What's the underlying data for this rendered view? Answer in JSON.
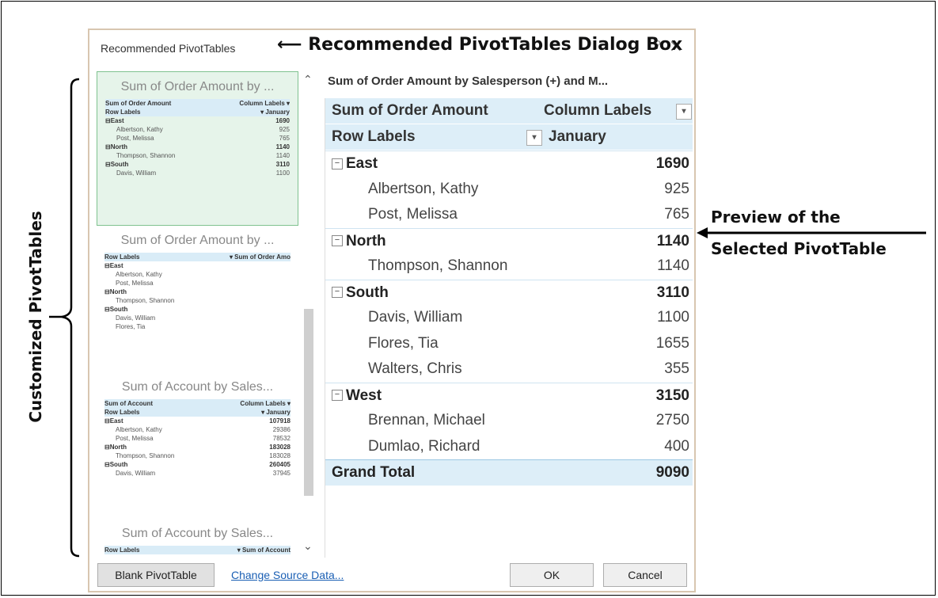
{
  "dialog": {
    "title": "Recommended PivotTables",
    "help_glyph": "?",
    "close_glyph": "×"
  },
  "annotations": {
    "dialog_box": "Recommended PivotTables Dialog Box",
    "preview_line1": "Preview of the",
    "preview_line2": "Selected PivotTable",
    "customized": "Customized PivotTables",
    "arrow_left": "⟵"
  },
  "gallery": {
    "thumbs": [
      {
        "title": "Sum of Order Amount by ...",
        "rows": [
          [
            "Sum of Order Amount",
            "Column Labels ▾",
            "hdr"
          ],
          [
            "Row Labels",
            "▾ January",
            "hdr"
          ],
          [
            "⊟East",
            "1690",
            "bold"
          ],
          [
            "Albertson, Kathy",
            "925",
            "sub"
          ],
          [
            "Post, Melissa",
            "765",
            "sub"
          ],
          [
            "⊟North",
            "1140",
            "bold"
          ],
          [
            "Thompson, Shannon",
            "1140",
            "sub"
          ],
          [
            "⊟South",
            "3110",
            "bold"
          ],
          [
            "Davis, William",
            "1100",
            "sub"
          ]
        ]
      },
      {
        "title": "Sum of Order Amount by ...",
        "rows": [
          [
            "Row Labels",
            "▾ Sum of Order Amo",
            "hdr"
          ],
          [
            "⊟East",
            "",
            "bold"
          ],
          [
            "Albertson, Kathy",
            "",
            "sub"
          ],
          [
            "Post, Melissa",
            "",
            "sub"
          ],
          [
            "⊟North",
            "",
            "bold"
          ],
          [
            "Thompson, Shannon",
            "",
            "sub"
          ],
          [
            "⊟South",
            "",
            "bold"
          ],
          [
            "Davis, William",
            "",
            "sub"
          ],
          [
            "Flores, Tia",
            "",
            "sub"
          ]
        ]
      },
      {
        "title": "Sum of Account by Sales...",
        "rows": [
          [
            "Sum of Account",
            "Column Labels ▾",
            "hdr"
          ],
          [
            "Row Labels",
            "▾ January",
            "hdr"
          ],
          [
            "⊟East",
            "107918",
            "bold"
          ],
          [
            "Albertson, Kathy",
            "29386",
            "sub"
          ],
          [
            "Post, Melissa",
            "78532",
            "sub"
          ],
          [
            "⊟North",
            "183028",
            "bold"
          ],
          [
            "Thompson, Shannon",
            "183028",
            "sub"
          ],
          [
            "⊟South",
            "260405",
            "bold"
          ],
          [
            "Davis, William",
            "37945",
            "sub"
          ]
        ]
      },
      {
        "title": "Sum of Account by Sales...",
        "rows": [
          [
            "Row Labels",
            "▾ Sum of Account",
            "hdr"
          ]
        ]
      }
    ]
  },
  "preview": {
    "title": "Sum of Order Amount by Salesperson (+) and M...",
    "header1_left": "Sum of Order Amount",
    "header1_right": "Column Labels",
    "header2_left": "Row Labels",
    "header2_right": "January",
    "rows": [
      {
        "label": "East",
        "value": "1690",
        "kind": "group"
      },
      {
        "label": "Albertson, Kathy",
        "value": "925",
        "kind": "item"
      },
      {
        "label": "Post, Melissa",
        "value": "765",
        "kind": "item"
      },
      {
        "label": "North",
        "value": "1140",
        "kind": "group"
      },
      {
        "label": "Thompson, Shannon",
        "value": "1140",
        "kind": "item"
      },
      {
        "label": "South",
        "value": "3110",
        "kind": "group"
      },
      {
        "label": "Davis, William",
        "value": "1100",
        "kind": "item"
      },
      {
        "label": "Flores, Tia",
        "value": "1655",
        "kind": "item"
      },
      {
        "label": "Walters, Chris",
        "value": "355",
        "kind": "item"
      },
      {
        "label": "West",
        "value": "3150",
        "kind": "group"
      },
      {
        "label": "Brennan, Michael",
        "value": "2750",
        "kind": "item"
      },
      {
        "label": "Dumlao, Richard",
        "value": "400",
        "kind": "item"
      },
      {
        "label": "Grand Total",
        "value": "9090",
        "kind": "total"
      }
    ]
  },
  "footer": {
    "blank_label": "Blank PivotTable",
    "change_source_label": "Change Source Data...",
    "ok_label": "OK",
    "cancel_label": "Cancel"
  }
}
